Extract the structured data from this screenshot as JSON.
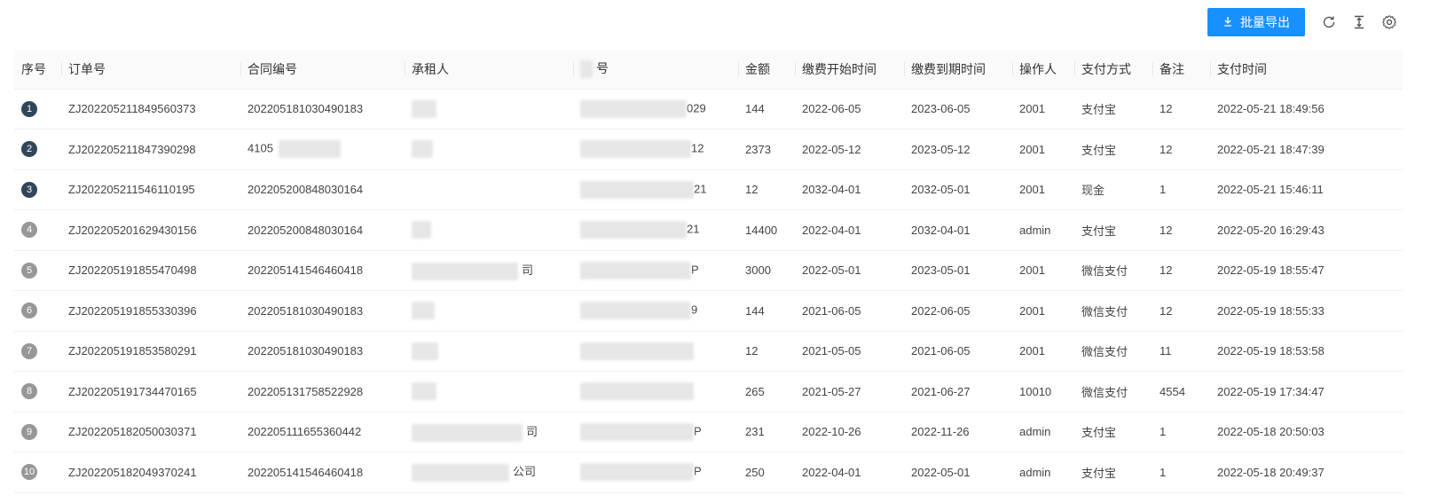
{
  "toolbar": {
    "export_label": "批量导出",
    "icons": [
      "download-icon",
      "reload-icon",
      "column-height-icon",
      "setting-icon"
    ]
  },
  "table": {
    "columns": [
      "序号",
      "订单号",
      "合同编号",
      "承租人",
      "号",
      "金额",
      "缴费开始时间",
      "缴费到期时间",
      "操作人",
      "支付方式",
      "备注",
      "支付时间"
    ],
    "rows": [
      {
        "idx": "1",
        "order": "ZJ202205211849560373",
        "contract": "202205181030490183",
        "tenant": "",
        "id_tail": "029",
        "amount": "144",
        "start": "2022-06-05",
        "end": "2023-06-05",
        "operator": "2001",
        "pay": "支付宝",
        "note": "12",
        "time": "2022-05-21 18:49:56"
      },
      {
        "idx": "2",
        "order": "ZJ202205211847390298",
        "contract": "4105",
        "tenant": "",
        "id_tail": "12",
        "amount": "2373",
        "start": "2022-05-12",
        "end": "2023-05-12",
        "operator": "2001",
        "pay": "支付宝",
        "note": "12",
        "time": "2022-05-21 18:47:39"
      },
      {
        "idx": "3",
        "order": "ZJ202205211546110195",
        "contract": "202205200848030164",
        "tenant": "",
        "id_tail": "21",
        "amount": "12",
        "start": "2032-04-01",
        "end": "2032-05-01",
        "operator": "2001",
        "pay": "现金",
        "note": "1",
        "time": "2022-05-21 15:46:11"
      },
      {
        "idx": "4",
        "order": "ZJ202205201629430156",
        "contract": "202205200848030164",
        "tenant": "",
        "id_tail": "21",
        "amount": "14400",
        "start": "2022-04-01",
        "end": "2032-04-01",
        "operator": "admin",
        "pay": "支付宝",
        "note": "12",
        "time": "2022-05-20 16:29:43"
      },
      {
        "idx": "5",
        "order": "ZJ202205191855470498",
        "contract": "202205141546460418",
        "tenant": "司",
        "id_tail": "P",
        "amount": "3000",
        "start": "2022-05-01",
        "end": "2023-05-01",
        "operator": "2001",
        "pay": "微信支付",
        "note": "12",
        "time": "2022-05-19 18:55:47"
      },
      {
        "idx": "6",
        "order": "ZJ202205191855330396",
        "contract": "202205181030490183",
        "tenant": "",
        "id_tail": "9",
        "amount": "144",
        "start": "2021-06-05",
        "end": "2022-06-05",
        "operator": "2001",
        "pay": "微信支付",
        "note": "12",
        "time": "2022-05-19 18:55:33"
      },
      {
        "idx": "7",
        "order": "ZJ202205191853580291",
        "contract": "202205181030490183",
        "tenant": "",
        "id_tail": "",
        "amount": "12",
        "start": "2021-05-05",
        "end": "2021-06-05",
        "operator": "2001",
        "pay": "微信支付",
        "note": "11",
        "time": "2022-05-19 18:53:58"
      },
      {
        "idx": "8",
        "order": "ZJ202205191734470165",
        "contract": "202205131758522928",
        "tenant": "",
        "id_tail": "",
        "amount": "265",
        "start": "2021-05-27",
        "end": "2021-06-27",
        "operator": "10010",
        "pay": "微信支付",
        "note": "4554",
        "time": "2022-05-19 17:34:47"
      },
      {
        "idx": "9",
        "order": "ZJ202205182050030371",
        "contract": "202205111655360442",
        "tenant": "司",
        "id_tail": "P",
        "amount": "231",
        "start": "2022-10-26",
        "end": "2022-11-26",
        "operator": "admin",
        "pay": "支付宝",
        "note": "1",
        "time": "2022-05-18 20:50:03"
      },
      {
        "idx": "10",
        "order": "ZJ202205182049370241",
        "contract": "202205141546460418",
        "tenant": "公司",
        "id_tail": "P",
        "amount": "250",
        "start": "2022-04-01",
        "end": "2022-05-01",
        "operator": "admin",
        "pay": "支付宝",
        "note": "1",
        "time": "2022-05-18 20:49:37"
      }
    ]
  }
}
